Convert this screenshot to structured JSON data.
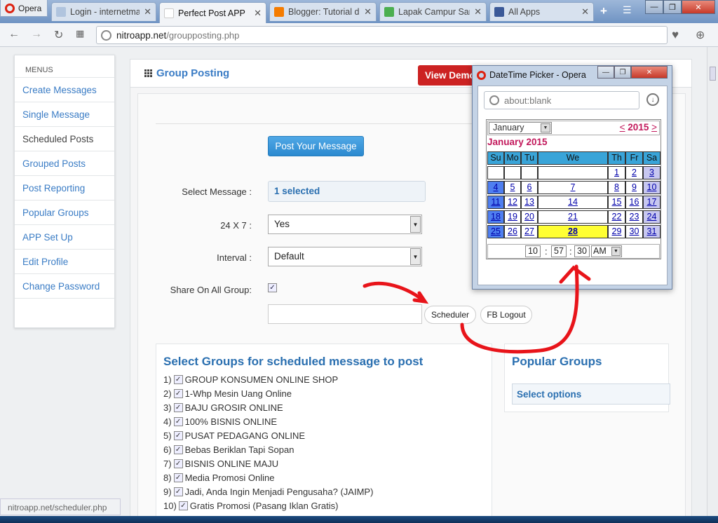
{
  "browser": {
    "menu_label": "Opera",
    "tabs": [
      {
        "label": "Login - internetma",
        "fav_color": "#b0c4de"
      },
      {
        "label": "Perfect Post APP",
        "fav_color": "#ffffff"
      },
      {
        "label": "Blogger: Tutorial da",
        "fav_color": "#f57c00"
      },
      {
        "label": "Lapak Campur Sari",
        "fav_color": "#4caf50"
      },
      {
        "label": "All Apps",
        "fav_color": "#3b5998"
      }
    ],
    "url_host": "nitroapp.net",
    "url_path": "/groupposting.php",
    "status_url": "nitroapp.net/scheduler.php"
  },
  "sidebar": {
    "header": "MENUS",
    "items": [
      "Create Messages",
      "Single Message",
      "Scheduled Posts",
      "Grouped Posts",
      "Post Reporting",
      "Popular Groups",
      "APP Set Up",
      "Edit Profile",
      "Change Password"
    ]
  },
  "main": {
    "title": "Group Posting",
    "view_demo": "View Demo",
    "post_button": "Post Your Message",
    "select_message_label": "Select Message :",
    "select_message_value": "1 selected",
    "mode_label": "24 X 7 :",
    "mode_value": "Yes",
    "interval_label": "Interval :",
    "interval_value": "Default",
    "share_label": "Share On All Group:",
    "scheduler_button": "Scheduler",
    "fb_logout_button": "FB Logout"
  },
  "groups": {
    "title": "Select Groups for scheduled message to post",
    "items": [
      {
        "n": "1)",
        "name": "GROUP KONSUMEN ONLINE SHOP"
      },
      {
        "n": "2)",
        "name": "1-Whp Mesin Uang Online"
      },
      {
        "n": "3)",
        "name": "BAJU GROSIR ONLINE"
      },
      {
        "n": "4)",
        "name": "100% BISNIS ONLINE"
      },
      {
        "n": "5)",
        "name": "PUSAT PEDAGANG ONLINE"
      },
      {
        "n": "6)",
        "name": "Bebas Beriklan Tapi Sopan"
      },
      {
        "n": "7)",
        "name": "BISNIS ONLINE MAJU"
      },
      {
        "n": "8)",
        "name": "Media Promosi Online"
      },
      {
        "n": "9)",
        "name": "Jadi, Anda Ingin Menjadi Pengusaha? (JAIMP)"
      },
      {
        "n": "10)",
        "name": "Gratis Promosi (Pasang Iklan Gratis)"
      }
    ]
  },
  "popular": {
    "title": "Popular Groups",
    "select_label": "Select options"
  },
  "picker": {
    "window_title": "DateTime Picker - Opera",
    "address": "about:blank",
    "month_select": "January",
    "year": "2015",
    "prev": "<",
    "next": ">",
    "month_heading": "January 2015",
    "weekdays": [
      "Su",
      "Mo",
      "Tu",
      "We",
      "Th",
      "Fr",
      "Sa"
    ],
    "weeks": [
      [
        "",
        "",
        "",
        "",
        "1",
        "2",
        "3"
      ],
      [
        "4",
        "5",
        "6",
        "7",
        "8",
        "9",
        "10"
      ],
      [
        "11",
        "12",
        "13",
        "14",
        "15",
        "16",
        "17"
      ],
      [
        "18",
        "19",
        "20",
        "21",
        "22",
        "23",
        "24"
      ],
      [
        "25",
        "26",
        "27",
        "28",
        "29",
        "30",
        "31"
      ]
    ],
    "selected_day": "28",
    "hour": "10",
    "minute": "57",
    "second": "30",
    "ampm": "AM",
    "colors": {
      "header": "#39a4d8",
      "weekend": "#c7c7f0",
      "sunday": "#4f7ff0",
      "today": "#ffff33",
      "accent": "#c2185b"
    }
  },
  "colors": {
    "brand_blue": "#2a6fb0",
    "demo_red": "#cc2222",
    "annotation_red": "#e8141a"
  }
}
